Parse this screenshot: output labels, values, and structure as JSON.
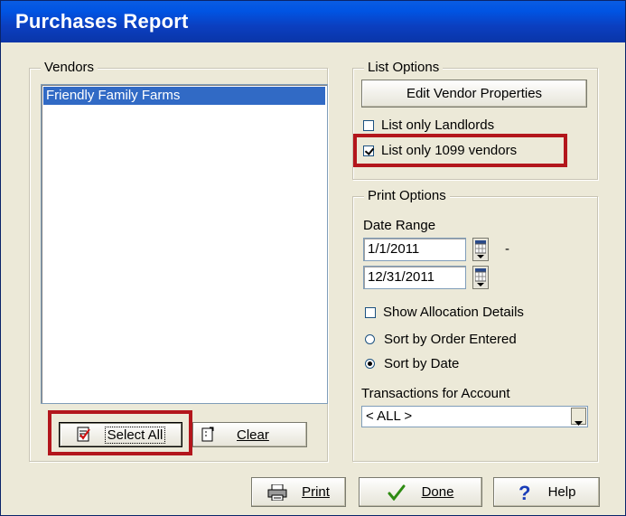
{
  "window": {
    "title": "Purchases Report"
  },
  "vendors": {
    "legend": "Vendors",
    "items": [
      {
        "label": "Friendly Family Farms",
        "selected": true
      }
    ],
    "select_all_label": "Select All",
    "clear_label": "Clear"
  },
  "list_options": {
    "legend": "List Options",
    "edit_vendor_label": "Edit Vendor Properties",
    "landlords_label": "List only Landlords",
    "landlords_checked": false,
    "vendors_1099_label": "List only 1099 vendors",
    "vendors_1099_checked": true
  },
  "print_options": {
    "legend": "Print Options",
    "date_range_label": "Date Range",
    "start_date": "1/1/2011",
    "end_date": "12/31/2011",
    "dash": "-",
    "show_allocation_label": "Show Allocation Details",
    "sort_order_entered_label": "Sort by Order Entered",
    "sort_date_label": "Sort by Date",
    "selected_sort": "Sort by Date",
    "transactions_label": "Transactions for Account",
    "account_value": "< ALL >"
  },
  "footer": {
    "print_label": "Print",
    "done_label": "Done",
    "help_label": "Help"
  },
  "colors": {
    "title_bar": "#0a35a8",
    "highlight_box": "#b3161c",
    "selection": "#316ac5"
  }
}
